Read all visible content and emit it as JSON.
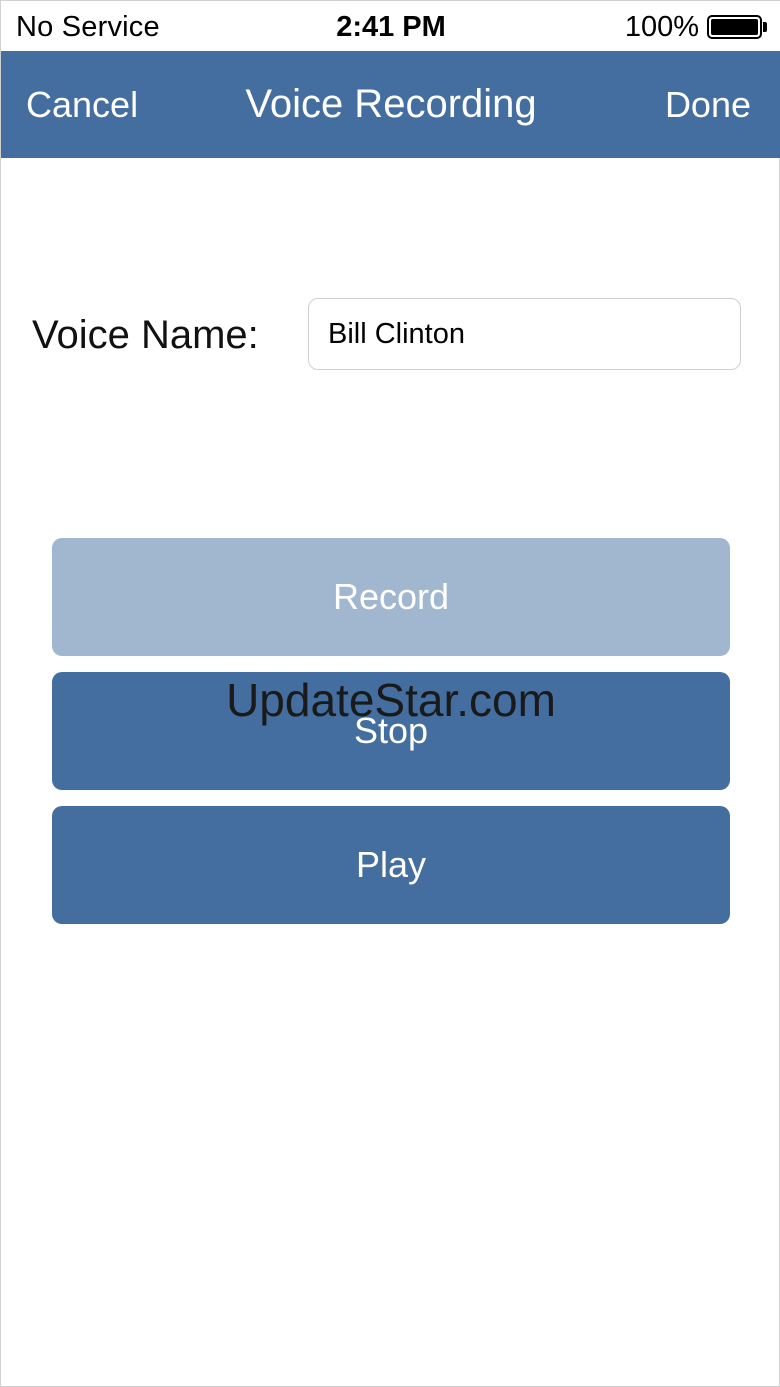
{
  "status_bar": {
    "carrier": "No Service",
    "time": "2:41 PM",
    "battery_percent": "100%",
    "battery_level": 1.0
  },
  "nav_bar": {
    "cancel_label": "Cancel",
    "title": "Voice Recording",
    "done_label": "Done",
    "background_color": "#436e9f"
  },
  "form": {
    "voice_name_label": "Voice Name:",
    "voice_name_value": "Bill Clinton"
  },
  "controls": {
    "record_label": "Record",
    "stop_label": "Stop",
    "play_label": "Play",
    "record_color": "#a1b7d0",
    "button_color": "#436e9f"
  },
  "watermark": {
    "text": "UpdateStar.com"
  }
}
